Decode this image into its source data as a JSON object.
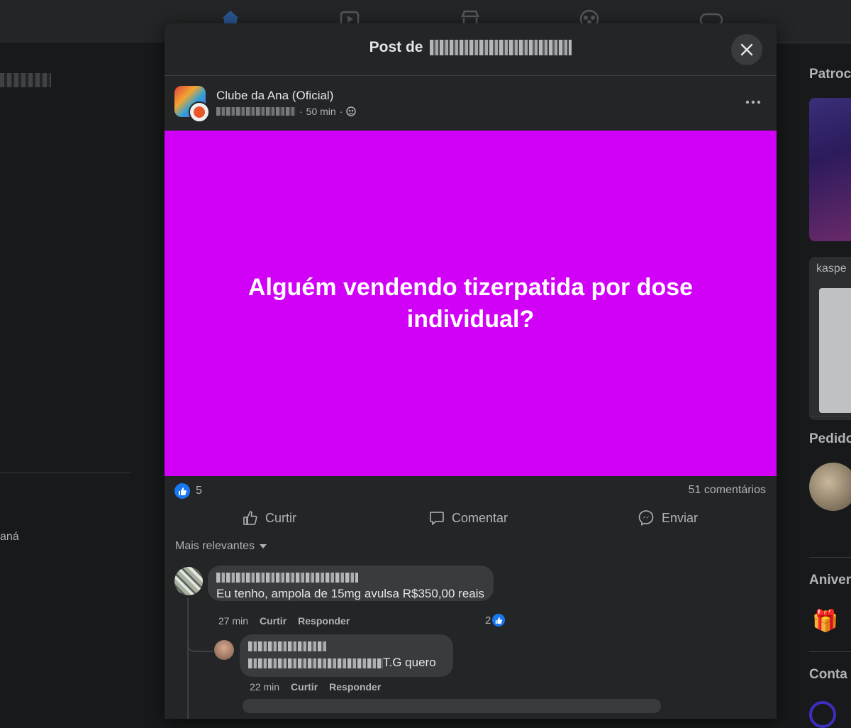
{
  "modal": {
    "title_prefix": "Post de",
    "close_icon": "close-icon"
  },
  "post": {
    "page_name": "Clube da Ana (Oficial)",
    "time": "50 min",
    "separator": "·",
    "text": "Alguém vendendo tizerpatida por dose individual?",
    "image_bg": "#d100f7",
    "likes": "5",
    "comments": "51 comentários"
  },
  "actions": {
    "like": "Curtir",
    "comment": "Comentar",
    "send": "Enviar"
  },
  "sort": {
    "label": "Mais relevantes"
  },
  "comments": [
    {
      "text": "Eu tenho, ampola de 15mg avulsa R$350,00 reais",
      "time": "27 min",
      "like": "Curtir",
      "reply": "Responder",
      "reactions": "2"
    },
    {
      "text_suffix": "T.G quero",
      "time": "22 min",
      "like": "Curtir",
      "reply": "Responder"
    }
  ],
  "left": {
    "partial_text": "aná"
  },
  "right": {
    "heading_1": "Patroc",
    "ad_brand": "kaspe",
    "heading_2": "Pedido",
    "heading_3": "Aniver",
    "heading_4": "Conta"
  },
  "colors": {
    "background": "#18191a",
    "surface": "#242526",
    "bubble": "#3a3b3c",
    "accent": "#1877f2"
  }
}
